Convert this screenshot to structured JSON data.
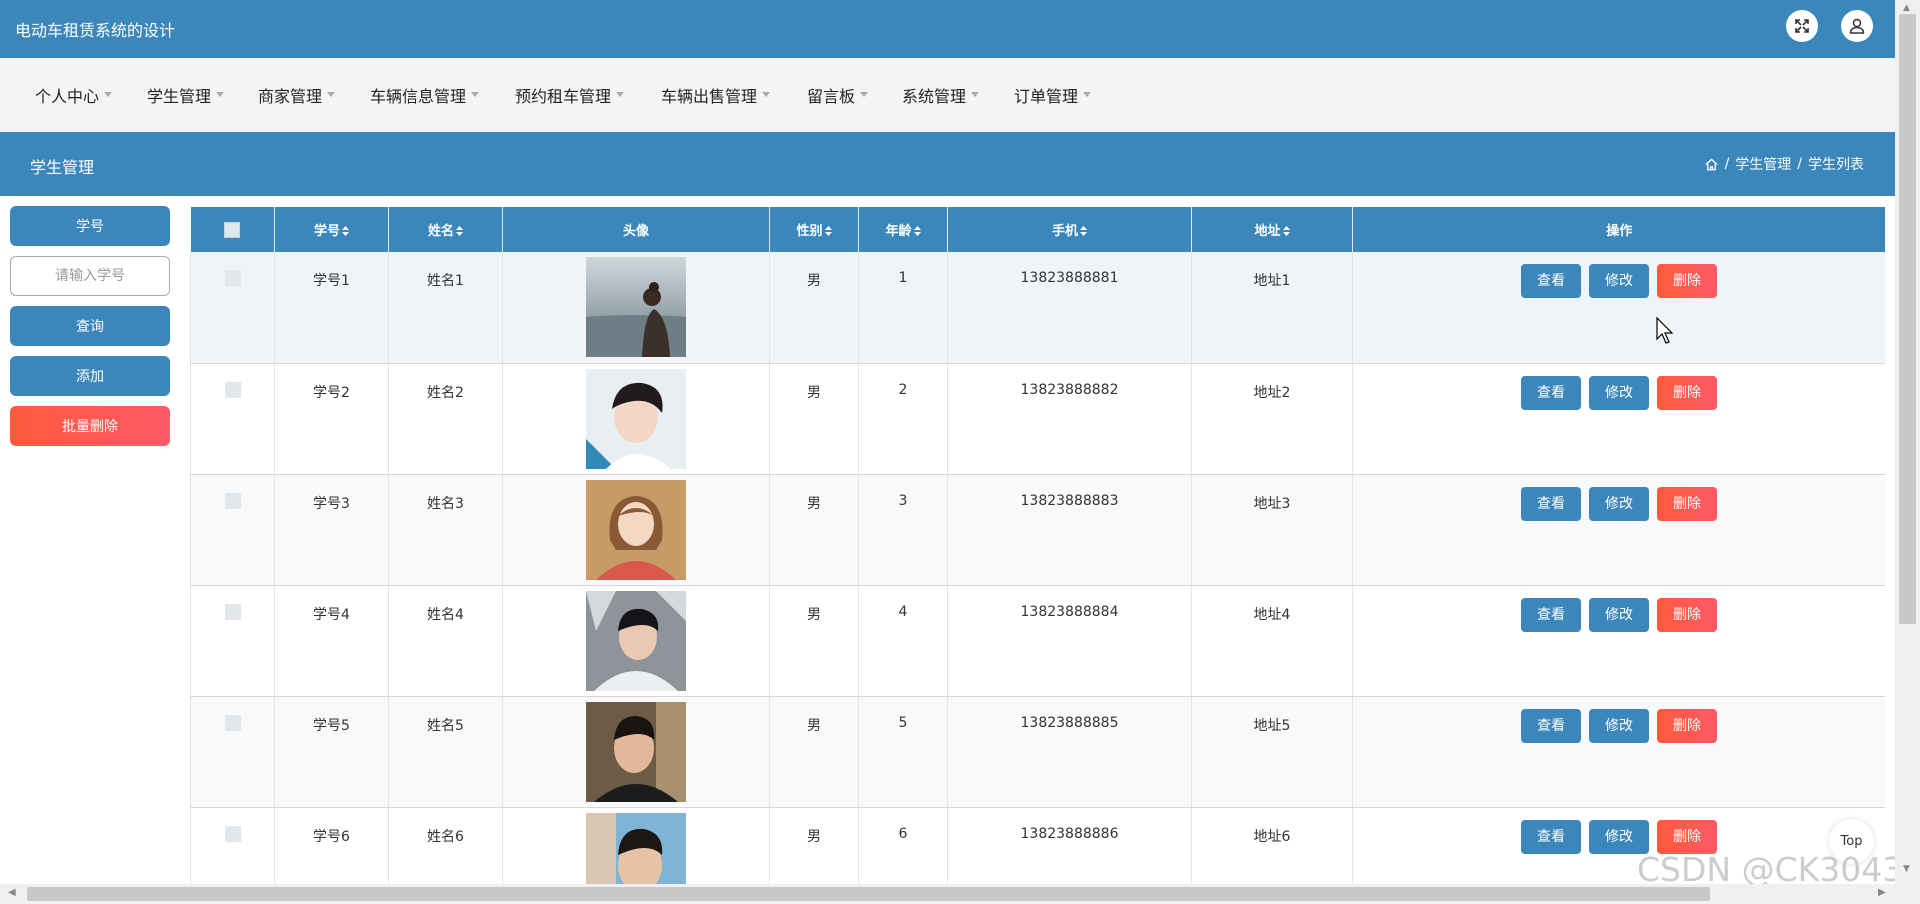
{
  "app": {
    "title": "电动车租赁系统的设计"
  },
  "topbar": {
    "fullscreen_icon": "expand-icon",
    "user_icon": "user-icon"
  },
  "menu": [
    {
      "label": "个人中心"
    },
    {
      "label": "学生管理"
    },
    {
      "label": "商家管理"
    },
    {
      "label": "车辆信息管理"
    },
    {
      "label": "预约租车管理"
    },
    {
      "label": "车辆出售管理"
    },
    {
      "label": "留言板"
    },
    {
      "label": "系统管理"
    },
    {
      "label": "订单管理"
    }
  ],
  "page": {
    "title": "学生管理",
    "breadcrumb": [
      "学生管理",
      "学生列表"
    ],
    "home_icon": "home-icon"
  },
  "sidebar": {
    "field_label": "学号",
    "search_placeholder": "请输入学号",
    "search_value": "",
    "query_label": "查询",
    "add_label": "添加",
    "batch_delete_label": "批量删除"
  },
  "table": {
    "headers": {
      "id": "学号",
      "name": "姓名",
      "avatar": "头像",
      "gender": "性别",
      "age": "年龄",
      "phone": "手机",
      "address": "地址",
      "actions": "操作"
    },
    "actions": {
      "view": "查看",
      "edit": "修改",
      "delete": "删除"
    },
    "rows": [
      {
        "id": "学号1",
        "name": "姓名1",
        "gender": "男",
        "age": "1",
        "phone": "13823888881",
        "address": "地址1"
      },
      {
        "id": "学号2",
        "name": "姓名2",
        "gender": "男",
        "age": "2",
        "phone": "13823888882",
        "address": "地址2"
      },
      {
        "id": "学号3",
        "name": "姓名3",
        "gender": "男",
        "age": "3",
        "phone": "13823888883",
        "address": "地址3"
      },
      {
        "id": "学号4",
        "name": "姓名4",
        "gender": "男",
        "age": "4",
        "phone": "13823888884",
        "address": "地址4"
      },
      {
        "id": "学号5",
        "name": "姓名5",
        "gender": "男",
        "age": "5",
        "phone": "13823888885",
        "address": "地址5"
      },
      {
        "id": "学号6",
        "name": "姓名6",
        "gender": "男",
        "age": "6",
        "phone": "13823888886",
        "address": "地址6"
      }
    ]
  },
  "back_to_top": "Top",
  "watermark": "CSDN @CK3043",
  "colors": {
    "primary": "#3b87bb",
    "danger": "#ff5a4e",
    "menu_bg": "#f4f4f4"
  }
}
